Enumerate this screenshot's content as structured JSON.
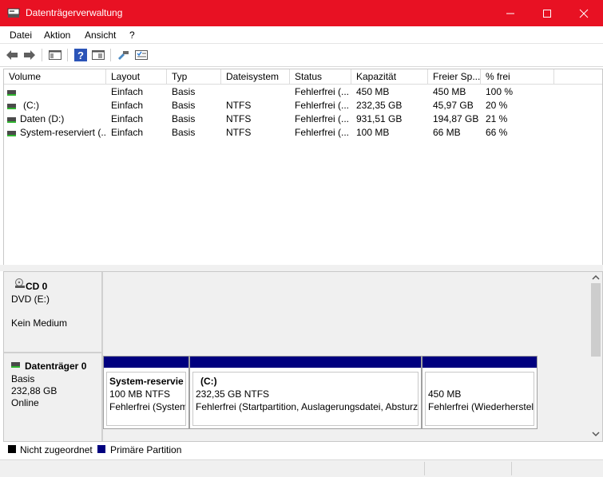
{
  "window": {
    "title": "Datenträgerverwaltung",
    "accent": "#e81123"
  },
  "menu": [
    "Datei",
    "Aktion",
    "Ansicht",
    "?"
  ],
  "toolbar": [
    "back-arrow-icon",
    "forward-arrow-icon",
    "console-tree-icon",
    "help-icon",
    "properties-icon",
    "rescan-icon",
    "disk-list-icon"
  ],
  "volumes": {
    "columns": [
      "Volume",
      "Layout",
      "Typ",
      "Dateisystem",
      "Status",
      "Kapazität",
      "Freier Sp...",
      "% frei"
    ],
    "rows": [
      [
        "",
        "Einfach",
        "Basis",
        "",
        "Fehlerfrei (...",
        "450 MB",
        "450 MB",
        "100 %"
      ],
      [
        "(C:)",
        "Einfach",
        "Basis",
        "NTFS",
        "Fehlerfrei (...",
        "232,35 GB",
        "45,97 GB",
        "20 %"
      ],
      [
        "Daten (D:)",
        "Einfach",
        "Basis",
        "NTFS",
        "Fehlerfrei (...",
        "931,51 GB",
        "194,87 GB",
        "21 %"
      ],
      [
        "System-reserviert (...",
        "Einfach",
        "Basis",
        "NTFS",
        "Fehlerfrei (...",
        "100 MB",
        "66 MB",
        "66 %"
      ]
    ]
  },
  "disks": {
    "cd0": {
      "name": "CD 0",
      "line1": "DVD (E:)",
      "line2": "Kein Medium"
    },
    "disk0": {
      "name": "Datenträger 0",
      "type": "Basis",
      "size": "232,88 GB",
      "state": "Online",
      "partitions": [
        {
          "title": "System-reservie",
          "size": "100 MB NTFS",
          "status": "Fehlerfrei (System"
        },
        {
          "title": "(C:)",
          "size": "232,35 GB NTFS",
          "status": "Fehlerfrei (Startpartition, Auslagerungsdatei, Absturz"
        },
        {
          "title": "",
          "size": "450 MB",
          "status": "Fehlerfrei (Wiederherstel"
        }
      ]
    }
  },
  "legend": [
    {
      "label": "Nicht zugeordnet",
      "color": "#000000"
    },
    {
      "label": "Primäre Partition",
      "color": "#00007f"
    }
  ]
}
